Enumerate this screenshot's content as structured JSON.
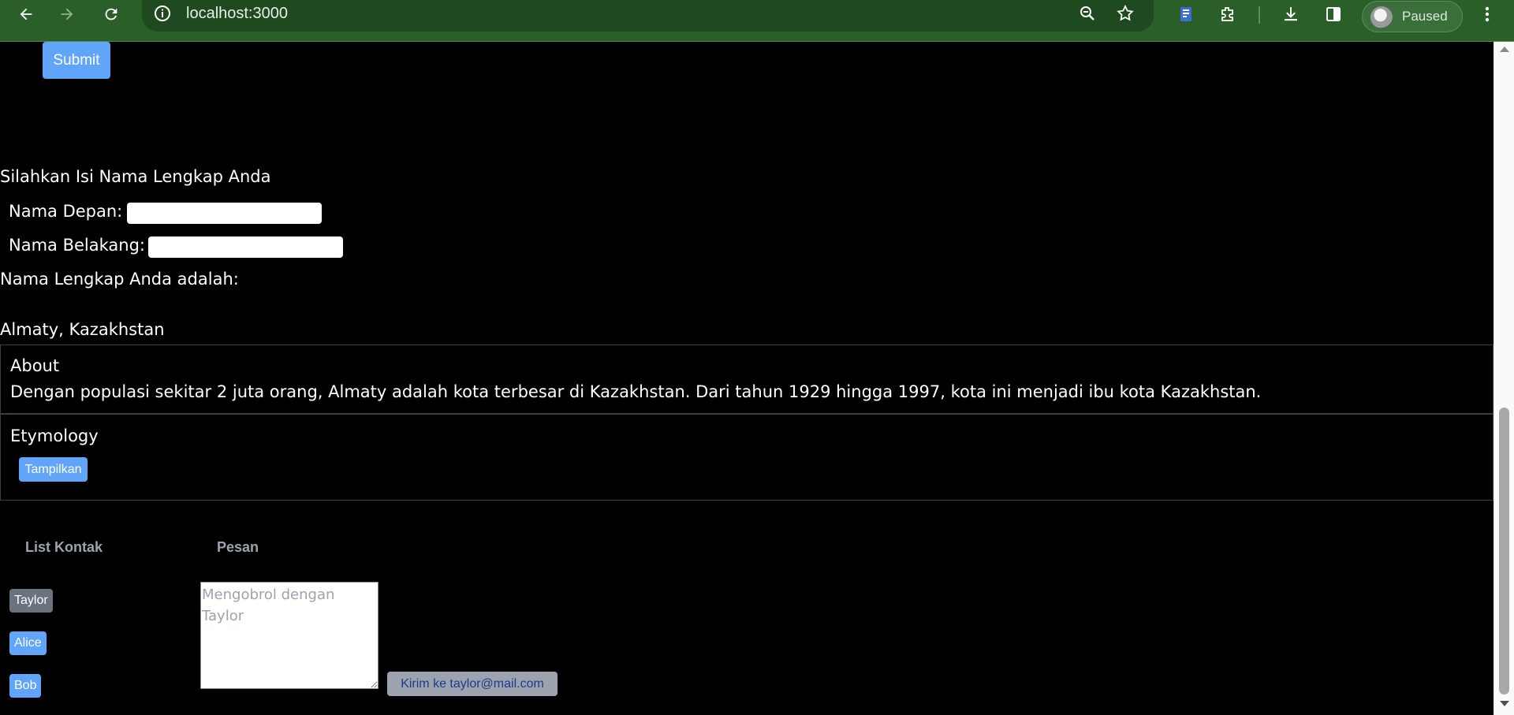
{
  "browser": {
    "url": "localhost:3000",
    "profile_status": "Paused"
  },
  "form": {
    "submit_label": "Submit"
  },
  "name_form": {
    "heading": "Silahkan Isi Nama Lengkap Anda",
    "first_name_label": "Nama Depan:",
    "first_name_value": "",
    "last_name_label": "Nama Belakang:",
    "last_name_value": "",
    "result_label": "Nama Lengkap Anda adalah:"
  },
  "city": {
    "title": "Almaty, Kazakhstan",
    "about_heading": "About",
    "about_text": "Dengan populasi sekitar 2 juta orang, Almaty adalah kota terbesar di Kazakhstan. Dari tahun 1929 hingga 1997, kota ini menjadi ibu kota Kazakhstan.",
    "etymology_heading": "Etymology",
    "show_button": "Tampilkan"
  },
  "chat": {
    "contacts_heading": "List Kontak",
    "message_heading": "Pesan",
    "contacts": [
      {
        "name": "Taylor",
        "selected": true
      },
      {
        "name": "Alice",
        "selected": false
      },
      {
        "name": "Bob",
        "selected": false
      }
    ],
    "message_placeholder": "Mengobrol dengan Taylor",
    "send_label": "Kirim ke taylor@mail.com"
  },
  "colors": {
    "chrome_bg": "#2a5f2a",
    "accent_button": "#60a5fa",
    "selected_contact": "#6b7280",
    "page_bg": "#000000"
  }
}
